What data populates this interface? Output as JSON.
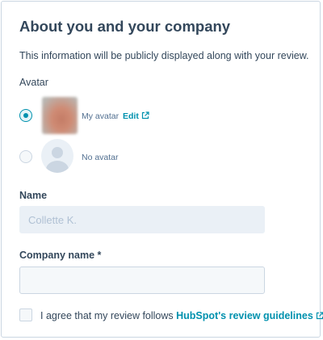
{
  "section": {
    "title": "About you and your company",
    "description": "This information will be publicly displayed along with your review."
  },
  "avatar": {
    "label": "Avatar",
    "options": [
      {
        "label": "My avatar",
        "edit_label": "Edit",
        "selected": true
      },
      {
        "label": "No avatar",
        "selected": false
      }
    ]
  },
  "name_field": {
    "label": "Name",
    "placeholder": "Collette K.",
    "value": ""
  },
  "company_field": {
    "label": "Company name *",
    "placeholder": "",
    "value": ""
  },
  "agreement": {
    "text": "I agree that my review follows ",
    "link_text": "HubSpot's review guidelines",
    "checked": false
  },
  "colors": {
    "accent": "#0091ae",
    "text": "#33475b",
    "border": "#cbd6e2"
  },
  "icons": [
    "external-link-icon",
    "avatar-placeholder-icon",
    "radio-selected-icon"
  ]
}
